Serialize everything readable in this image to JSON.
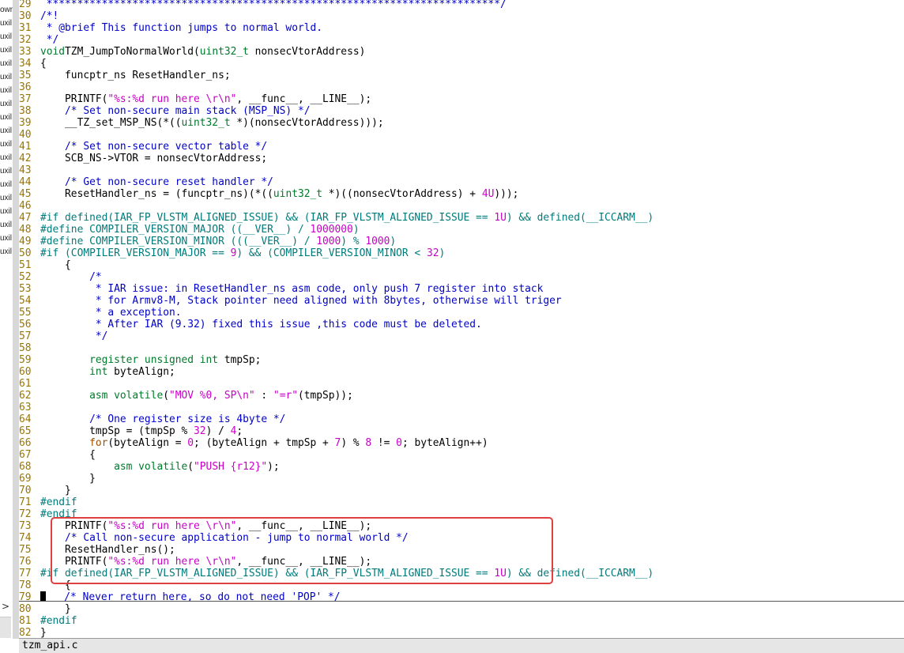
{
  "sidebar": {
    "items": [
      "own",
      "uxil",
      "uxil",
      "uxil",
      "uxil",
      "uxil",
      "uxil",
      "uxil",
      "uxil",
      "uxil",
      "uxil",
      "uxil",
      "uxil",
      "uxil",
      "uxil",
      "uxil",
      "uxil",
      "uxil",
      "uxil"
    ],
    "collapse_arrow": ">"
  },
  "status": {
    "filename": "tzm_api.c"
  },
  "colors": {
    "line_number": "#9a7500",
    "comment": "#0000c8",
    "string": "#c800c8",
    "type": "#007a2a",
    "keyword": "#a05000",
    "preprocessor": "#007a7a",
    "highlight_box": "#e04040"
  },
  "lines": [
    {
      "n": "29",
      "t": [
        [
          "cmt",
          " **************************************************************************/"
        ]
      ]
    },
    {
      "n": "30",
      "t": [
        [
          "cmt",
          "/*!"
        ]
      ]
    },
    {
      "n": "31",
      "t": [
        [
          "cmt",
          " * @brief This function jumps to normal world."
        ]
      ]
    },
    {
      "n": "32",
      "t": [
        [
          "cmt",
          " */"
        ]
      ]
    },
    {
      "n": "33",
      "t": [
        [
          "type",
          "void"
        ],
        [
          "",
          "TZM_JumpToNormalWorld("
        ],
        [
          "type",
          "uint32_t"
        ],
        [
          "",
          " nonsecVtorAddress)"
        ]
      ]
    },
    {
      "n": "34",
      "t": [
        [
          "",
          "{"
        ]
      ]
    },
    {
      "n": "35",
      "t": [
        [
          "",
          "    funcptr_ns ResetHandler_ns;"
        ]
      ]
    },
    {
      "n": "36",
      "t": []
    },
    {
      "n": "37",
      "t": [
        [
          "",
          "    PRINTF("
        ],
        [
          "str",
          "\"%s:%d run here \\r\\n\""
        ],
        [
          "",
          ", __func__, __LINE__);"
        ]
      ]
    },
    {
      "n": "38",
      "t": [
        [
          "cmt",
          "    /* Set non-secure main stack (MSP_NS) */"
        ]
      ]
    },
    {
      "n": "39",
      "t": [
        [
          "",
          "    __TZ_set_MSP_NS(*(("
        ],
        [
          "type",
          "uint32_t"
        ],
        [
          "",
          " *)(nonsecVtorAddress)));"
        ]
      ]
    },
    {
      "n": "40",
      "t": []
    },
    {
      "n": "41",
      "t": [
        [
          "cmt",
          "    /* Set non-secure vector table */"
        ]
      ]
    },
    {
      "n": "42",
      "t": [
        [
          "",
          "    SCB_NS->VTOR = nonsecVtorAddress;"
        ]
      ]
    },
    {
      "n": "43",
      "t": []
    },
    {
      "n": "44",
      "t": [
        [
          "cmt",
          "    /* Get non-secure reset handler */"
        ]
      ]
    },
    {
      "n": "45",
      "t": [
        [
          "",
          "    ResetHandler_ns = (funcptr_ns)(*(("
        ],
        [
          "type",
          "uint32_t"
        ],
        [
          "",
          " *)((nonsecVtorAddress) + "
        ],
        [
          "num",
          "4U"
        ],
        [
          "",
          ")));"
        ]
      ]
    },
    {
      "n": "46",
      "t": []
    },
    {
      "n": "47",
      "t": [
        [
          "pp",
          "#if defined(IAR_FP_VLSTM_ALIGNED_ISSUE) && (IAR_FP_VLSTM_ALIGNED_ISSUE == "
        ],
        [
          "num",
          "1U"
        ],
        [
          "pp",
          ") && defined(__ICCARM__)"
        ]
      ]
    },
    {
      "n": "48",
      "t": [
        [
          "pp",
          "#define COMPILER_VERSION_MAJOR ((__VER__) / "
        ],
        [
          "num",
          "1000000"
        ],
        [
          "pp",
          ")"
        ]
      ]
    },
    {
      "n": "49",
      "t": [
        [
          "pp",
          "#define COMPILER_VERSION_MINOR (((__VER__) / "
        ],
        [
          "num",
          "1000"
        ],
        [
          "pp",
          ") % "
        ],
        [
          "num",
          "1000"
        ],
        [
          "pp",
          ")"
        ]
      ]
    },
    {
      "n": "50",
      "t": [
        [
          "pp",
          "#if (COMPILER_VERSION_MAJOR == "
        ],
        [
          "num",
          "9"
        ],
        [
          "pp",
          ") && (COMPILER_VERSION_MINOR < "
        ],
        [
          "num",
          "32"
        ],
        [
          "pp",
          ")"
        ]
      ]
    },
    {
      "n": "51",
      "t": [
        [
          "",
          "    {"
        ]
      ]
    },
    {
      "n": "52",
      "t": [
        [
          "cmt",
          "        /*"
        ]
      ]
    },
    {
      "n": "53",
      "t": [
        [
          "cmt",
          "         * IAR issue: in ResetHandler_ns asm code, only push 7 register into stack"
        ]
      ]
    },
    {
      "n": "54",
      "t": [
        [
          "cmt",
          "         * for Armv8-M, Stack pointer need aligned with 8bytes, otherwise will triger"
        ]
      ]
    },
    {
      "n": "55",
      "t": [
        [
          "cmt",
          "         * a exception."
        ]
      ]
    },
    {
      "n": "56",
      "t": [
        [
          "cmt",
          "         * After IAR (9.32) fixed this issue ,this code must be deleted."
        ]
      ]
    },
    {
      "n": "57",
      "t": [
        [
          "cmt",
          "         */"
        ]
      ]
    },
    {
      "n": "58",
      "t": []
    },
    {
      "n": "59",
      "t": [
        [
          "type",
          "        register unsigned int"
        ],
        [
          "",
          " tmpSp;"
        ]
      ]
    },
    {
      "n": "60",
      "t": [
        [
          "type",
          "        int"
        ],
        [
          "",
          " byteAlign;"
        ]
      ]
    },
    {
      "n": "61",
      "t": []
    },
    {
      "n": "62",
      "t": [
        [
          "type",
          "        asm volatile"
        ],
        [
          "",
          "("
        ],
        [
          "str",
          "\"MOV %0, SP\\n\""
        ],
        [
          "",
          " : "
        ],
        [
          "str",
          "\"=r\""
        ],
        [
          "",
          "(tmpSp));"
        ]
      ]
    },
    {
      "n": "63",
      "t": []
    },
    {
      "n": "64",
      "t": [
        [
          "cmt",
          "        /* One register size is 4byte */"
        ]
      ]
    },
    {
      "n": "65",
      "t": [
        [
          "",
          "        tmpSp = (tmpSp % "
        ],
        [
          "num",
          "32"
        ],
        [
          "",
          ") / "
        ],
        [
          "num",
          "4"
        ],
        [
          "",
          ";"
        ]
      ]
    },
    {
      "n": "66",
      "t": [
        [
          "kw",
          "        for"
        ],
        [
          "",
          "(byteAlign = "
        ],
        [
          "num",
          "0"
        ],
        [
          "",
          "; (byteAlign + tmpSp + "
        ],
        [
          "num",
          "7"
        ],
        [
          "",
          ") % "
        ],
        [
          "num",
          "8"
        ],
        [
          "",
          " != "
        ],
        [
          "num",
          "0"
        ],
        [
          "",
          "; byteAlign++)"
        ]
      ]
    },
    {
      "n": "67",
      "t": [
        [
          "",
          "        {"
        ]
      ]
    },
    {
      "n": "68",
      "t": [
        [
          "type",
          "            asm volatile"
        ],
        [
          "",
          "("
        ],
        [
          "str",
          "\"PUSH {r12}\""
        ],
        [
          "",
          ");"
        ]
      ]
    },
    {
      "n": "69",
      "t": [
        [
          "",
          "        }"
        ]
      ]
    },
    {
      "n": "70",
      "t": [
        [
          "",
          "    }"
        ]
      ]
    },
    {
      "n": "71",
      "t": [
        [
          "pp",
          "#endif"
        ]
      ]
    },
    {
      "n": "72",
      "t": [
        [
          "pp",
          "#endif"
        ]
      ]
    },
    {
      "n": "73",
      "t": [
        [
          "",
          "    PRINTF("
        ],
        [
          "str",
          "\"%s:%d run here \\r\\n\""
        ],
        [
          "",
          ", __func__, __LINE__);"
        ]
      ]
    },
    {
      "n": "74",
      "t": [
        [
          "cmt",
          "    /* Call non-secure application - jump to normal world */"
        ]
      ]
    },
    {
      "n": "75",
      "t": [
        [
          "",
          "    ResetHandler_ns();"
        ]
      ]
    },
    {
      "n": "76",
      "t": [
        [
          "",
          "    PRINTF("
        ],
        [
          "str",
          "\"%s:%d run here \\r\\n\""
        ],
        [
          "",
          ", __func__, __LINE__);"
        ]
      ]
    },
    {
      "n": "77",
      "t": [
        [
          "pp",
          "#if defined(IAR_FP_VLSTM_ALIGNED_ISSUE) && (IAR_FP_VLSTM_ALIGNED_ISSUE == "
        ],
        [
          "num",
          "1U"
        ],
        [
          "pp",
          ") && defined(__ICCARM__)"
        ]
      ]
    },
    {
      "n": "78",
      "t": [
        [
          "",
          "    {"
        ]
      ]
    },
    {
      "n": "79",
      "t": [
        [
          "cursor",
          ""
        ],
        [
          "",
          "   "
        ],
        [
          "cmt",
          "/* Never return here, so do not need 'POP' */"
        ]
      ]
    },
    {
      "n": "80",
      "t": [
        [
          "",
          "    }"
        ]
      ]
    },
    {
      "n": "81",
      "t": [
        [
          "pp",
          "#endif"
        ]
      ]
    },
    {
      "n": "82",
      "t": [
        [
          "",
          "}"
        ]
      ]
    }
  ]
}
